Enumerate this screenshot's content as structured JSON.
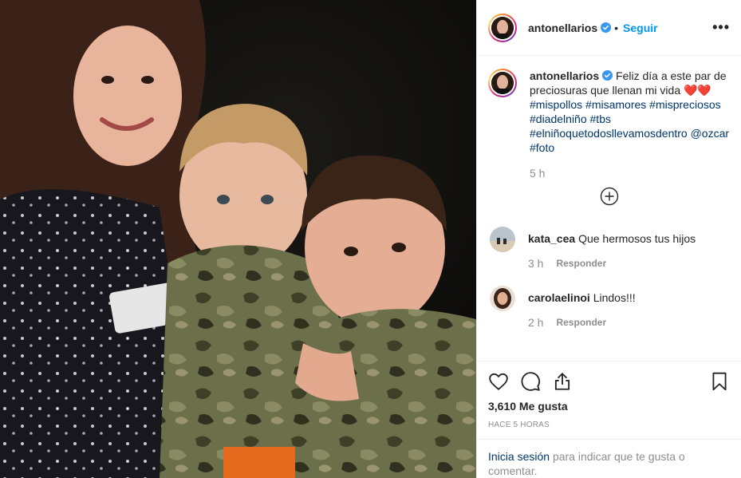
{
  "post": {
    "username": "antonellarios",
    "follow_label": "Seguir",
    "dot": "•",
    "more_label": "•••",
    "caption": {
      "text": "Feliz día a este par de preciosuras que llenan mi vida ❤️❤️",
      "hashtags": [
        "#mispollos",
        "#misamores",
        "#mispreciosos",
        "#diadelniño",
        "#tbs",
        "#elniñoquetodosllevamosdentro"
      ],
      "mention": "@ozcar",
      "last_hashtag": "#foto",
      "time": "5 h"
    },
    "comments": [
      {
        "username": "kata_cea",
        "text": "Que hermosos tus hijos",
        "time": "3 h",
        "reply_label": "Responder"
      },
      {
        "username": "carolaelinoi",
        "text": "Lindos!!!",
        "time": "2 h",
        "reply_label": "Responder"
      }
    ],
    "likes": "3,610 Me gusta",
    "ago": "HACE 5 HORAS",
    "login": {
      "link": "Inicia sesión",
      "rest": "para indicar que te gusta o comentar."
    }
  },
  "icons": {
    "verified": "verified-badge-icon",
    "like": "heart-icon",
    "comment": "comment-bubble-icon",
    "share": "share-icon",
    "save": "bookmark-icon",
    "load_more": "plus-circle-icon"
  },
  "colors": {
    "accent": "#0095f6",
    "link": "#00376b",
    "muted": "#8e8e8e",
    "border": "#efefef"
  }
}
